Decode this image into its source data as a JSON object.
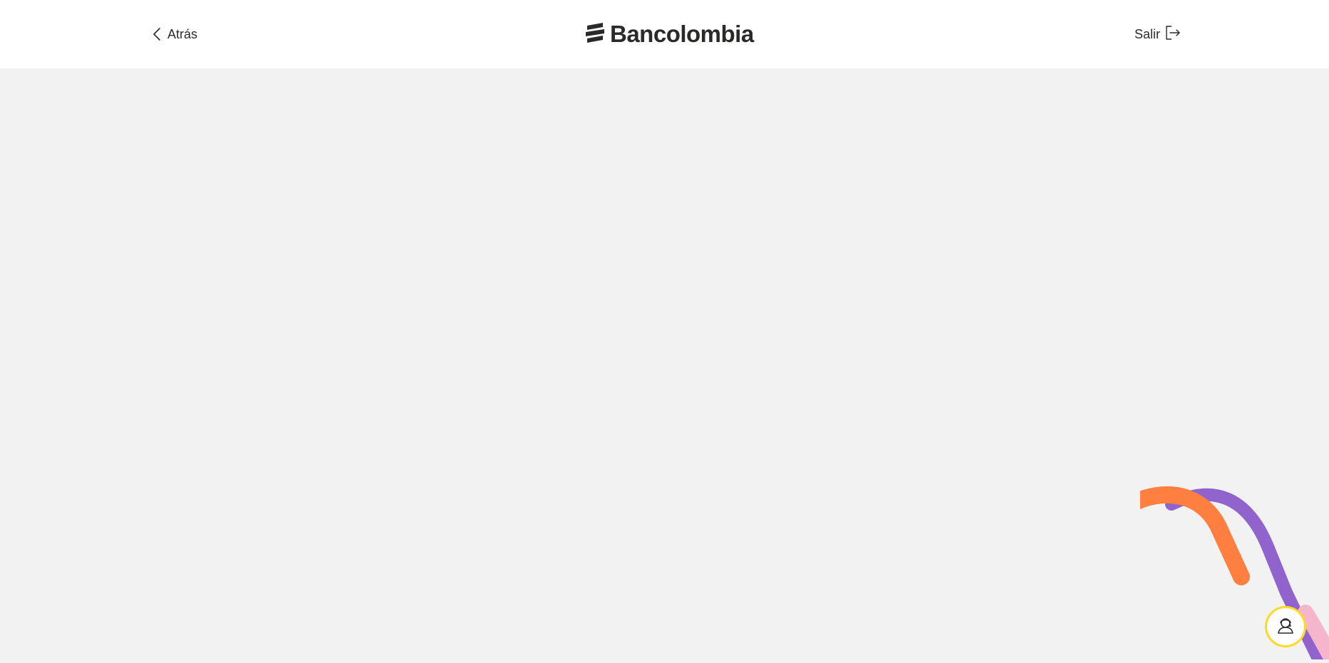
{
  "header": {
    "back_label": "Atrás",
    "exit_label": "Salir",
    "logo_text": "Bancolombia"
  },
  "icons": {
    "back": "chevron-left-icon",
    "exit": "logout-icon",
    "logo": "bancolombia-logo-icon",
    "help": "support-agent-icon"
  },
  "colors": {
    "header_bg": "#ffffff",
    "page_bg": "#f2f2f2",
    "text": "#2c2a29",
    "help_ring": "#fdda24",
    "decor_orange": "#ff7f41",
    "decor_purple": "#9063cd",
    "decor_pink": "#f5b6cd"
  }
}
